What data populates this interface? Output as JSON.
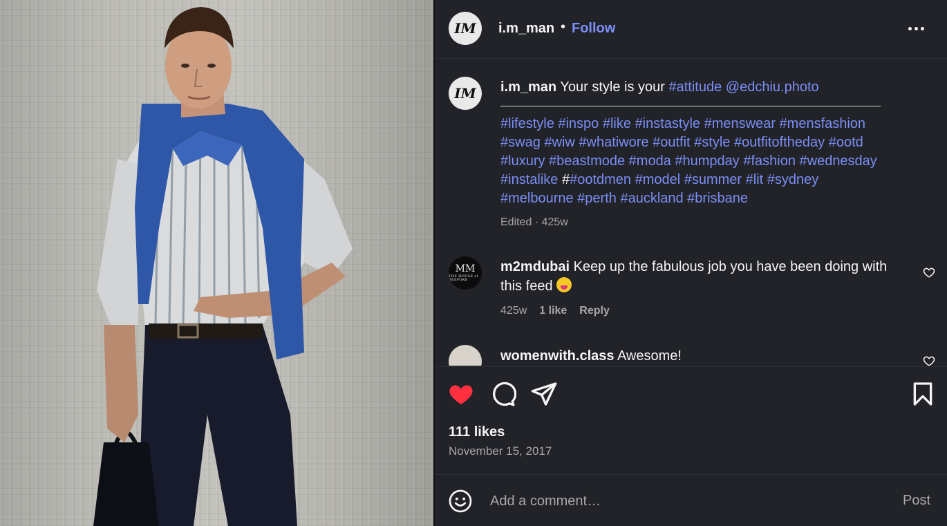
{
  "post": {
    "username": "i.m_man",
    "separator": "•",
    "follow_label": "Follow",
    "more_icon": "more-options-icon",
    "avatar_text": "IM"
  },
  "caption": {
    "username": "i.m_man",
    "text": "Your style is your",
    "tag_attitude": "#attitude",
    "mention": "@edchiu.photo",
    "hashtags_line1": "#lifestyle #inspo #like #instastyle #menswear #mensfashion",
    "hashtags_line2": "#swag #wiw #whatiwore #outfit #style #outfitoftheday #ootd",
    "hashtags_line3": "#luxury #beastmode #moda #humpday #fashion #wednesday",
    "hashtags_line4_a": "#instalike",
    "hashtags_line4_hash": "#",
    "hashtags_line4_b": "#ootdmen #model #summer #lit #sydney",
    "hashtags_line5": "#melbourne #perth #auckland #brisbane",
    "meta": "Edited · 425w"
  },
  "comments": [
    {
      "username": "m2mdubai",
      "text": "Keep up the fabulous job you have been doing with this feed",
      "avatar_text": "MM",
      "avatar_subtext": "THE HOUSE of BESPOKE",
      "age": "425w",
      "likes": "1 like",
      "reply": "Reply"
    },
    {
      "username": "womenwith.class",
      "text": "Awesome!"
    }
  ],
  "stats": {
    "likes": "111 likes",
    "date": "November 15, 2017"
  },
  "composer": {
    "placeholder": "Add a comment…",
    "post_label": "Post"
  },
  "colors": {
    "background": "#212328",
    "accent": "#7b8ef5",
    "like_red": "#ff3040",
    "muted": "#a8a8a8"
  }
}
